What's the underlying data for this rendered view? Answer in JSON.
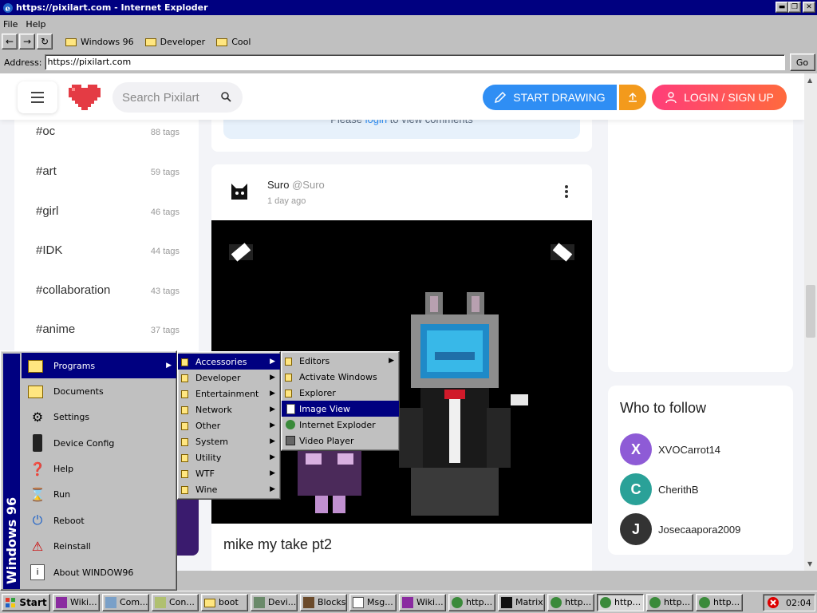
{
  "window": {
    "title": "https://pixilart.com - Internet Exploder"
  },
  "menubar": [
    "File",
    "Help"
  ],
  "favorites": [
    "Windows 96",
    "Developer",
    "Cool"
  ],
  "address": {
    "label": "Address:",
    "value": "https://pixilart.com",
    "go": "Go"
  },
  "site": {
    "search_placeholder": "Search Pixilart",
    "start_drawing": "START DRAWING",
    "login": "LOGIN / SIGN UP",
    "accent_blue": "#2f8ef4",
    "accent_pink": "#ff3d7a"
  },
  "tags": [
    {
      "name": "#oc",
      "count": "88 tags"
    },
    {
      "name": "#art",
      "count": "59 tags"
    },
    {
      "name": "#girl",
      "count": "46 tags"
    },
    {
      "name": "#IDK",
      "count": "44 tags"
    },
    {
      "name": "#collaboration",
      "count": "43 tags"
    },
    {
      "name": "#anime",
      "count": "37 tags"
    }
  ],
  "comments": {
    "pre": "Please ",
    "link": "login",
    "post": " to view comments"
  },
  "post": {
    "author": "Suro",
    "handle": "@Suro",
    "time": "1 day ago",
    "title": "mike my take pt2"
  },
  "follow": {
    "heading": "Who to follow",
    "users": [
      {
        "initial": "X",
        "name": "XVOCarrot14",
        "color": "#8e5bd6"
      },
      {
        "initial": "C",
        "name": "CherithB",
        "color": "#2aa198"
      },
      {
        "initial": "J",
        "name": "Josecaapora2009",
        "color": "#333333"
      }
    ]
  },
  "startmenu": {
    "brand": "Windows 96",
    "items": [
      "Programs",
      "Documents",
      "Settings",
      "Device Config",
      "Help",
      "Run",
      "Reboot",
      "Reinstall",
      "About WINDOW96"
    ]
  },
  "programs_menu": [
    "Accessories",
    "Developer",
    "Entertainment",
    "Network",
    "Other",
    "System",
    "Utility",
    "WTF",
    "Wine"
  ],
  "accessories_menu": [
    "Editors",
    "Activate Windows",
    "Explorer",
    "Image View",
    "Internet Exploder",
    "Video Player"
  ],
  "taskbar": {
    "start": "Start",
    "items": [
      "Wiki...",
      "Com...",
      "Con...",
      "boot",
      "Devi...",
      "Blocks",
      "Msg...",
      "Wiki...",
      "http...",
      "Matrix",
      "http...",
      "http...",
      "http...",
      "http..."
    ],
    "clock": "02:04"
  }
}
